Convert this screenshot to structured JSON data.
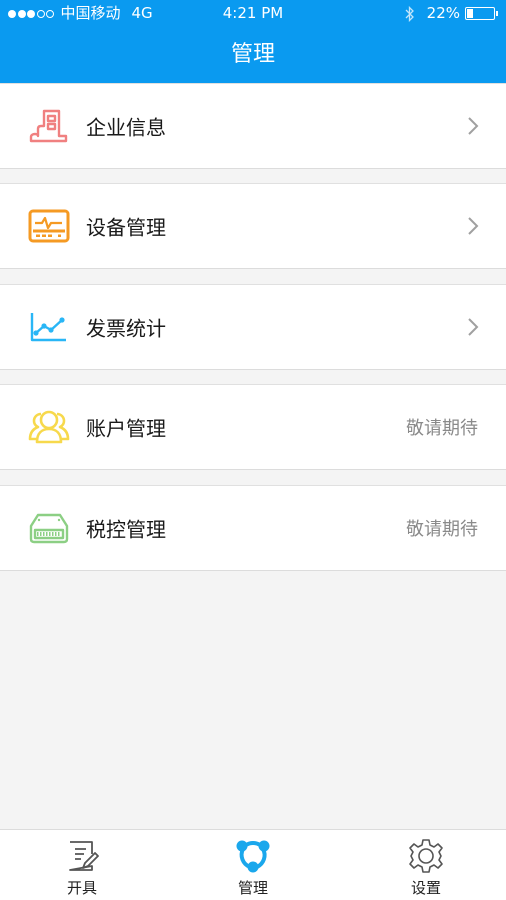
{
  "status_bar": {
    "signal_full": 3,
    "signal_empty": 2,
    "carrier": "中国移动",
    "network": "4G",
    "time": "4:21 PM",
    "bluetooth_icon": "bluetooth-icon",
    "battery_label": "22%",
    "battery_level": 0.22
  },
  "header": {
    "title": "管理"
  },
  "menu": [
    {
      "label": "企业信息",
      "icon": "building-icon",
      "color": "#f08080",
      "trailing": "chevron"
    },
    {
      "label": "设备管理",
      "icon": "device-monitor-icon",
      "color": "#f59a23",
      "trailing": "chevron"
    },
    {
      "label": "发票统计",
      "icon": "line-chart-icon",
      "color": "#29b6f6",
      "trailing": "chevron"
    },
    {
      "label": "账户管理",
      "icon": "users-icon",
      "color": "#f7d94c",
      "trailing": "text",
      "aside": "敬请期待"
    },
    {
      "label": "税控管理",
      "icon": "tax-device-icon",
      "color": "#8ccf84",
      "trailing": "text",
      "aside": "敬请期待"
    }
  ],
  "tabbar": {
    "tabs": [
      {
        "label": "开具",
        "icon": "invoice-edit-icon",
        "active": false
      },
      {
        "label": "管理",
        "icon": "manage-network-icon",
        "active": true
      },
      {
        "label": "设置",
        "icon": "gear-icon",
        "active": false
      }
    ],
    "active_color": "#1aa7ec"
  }
}
